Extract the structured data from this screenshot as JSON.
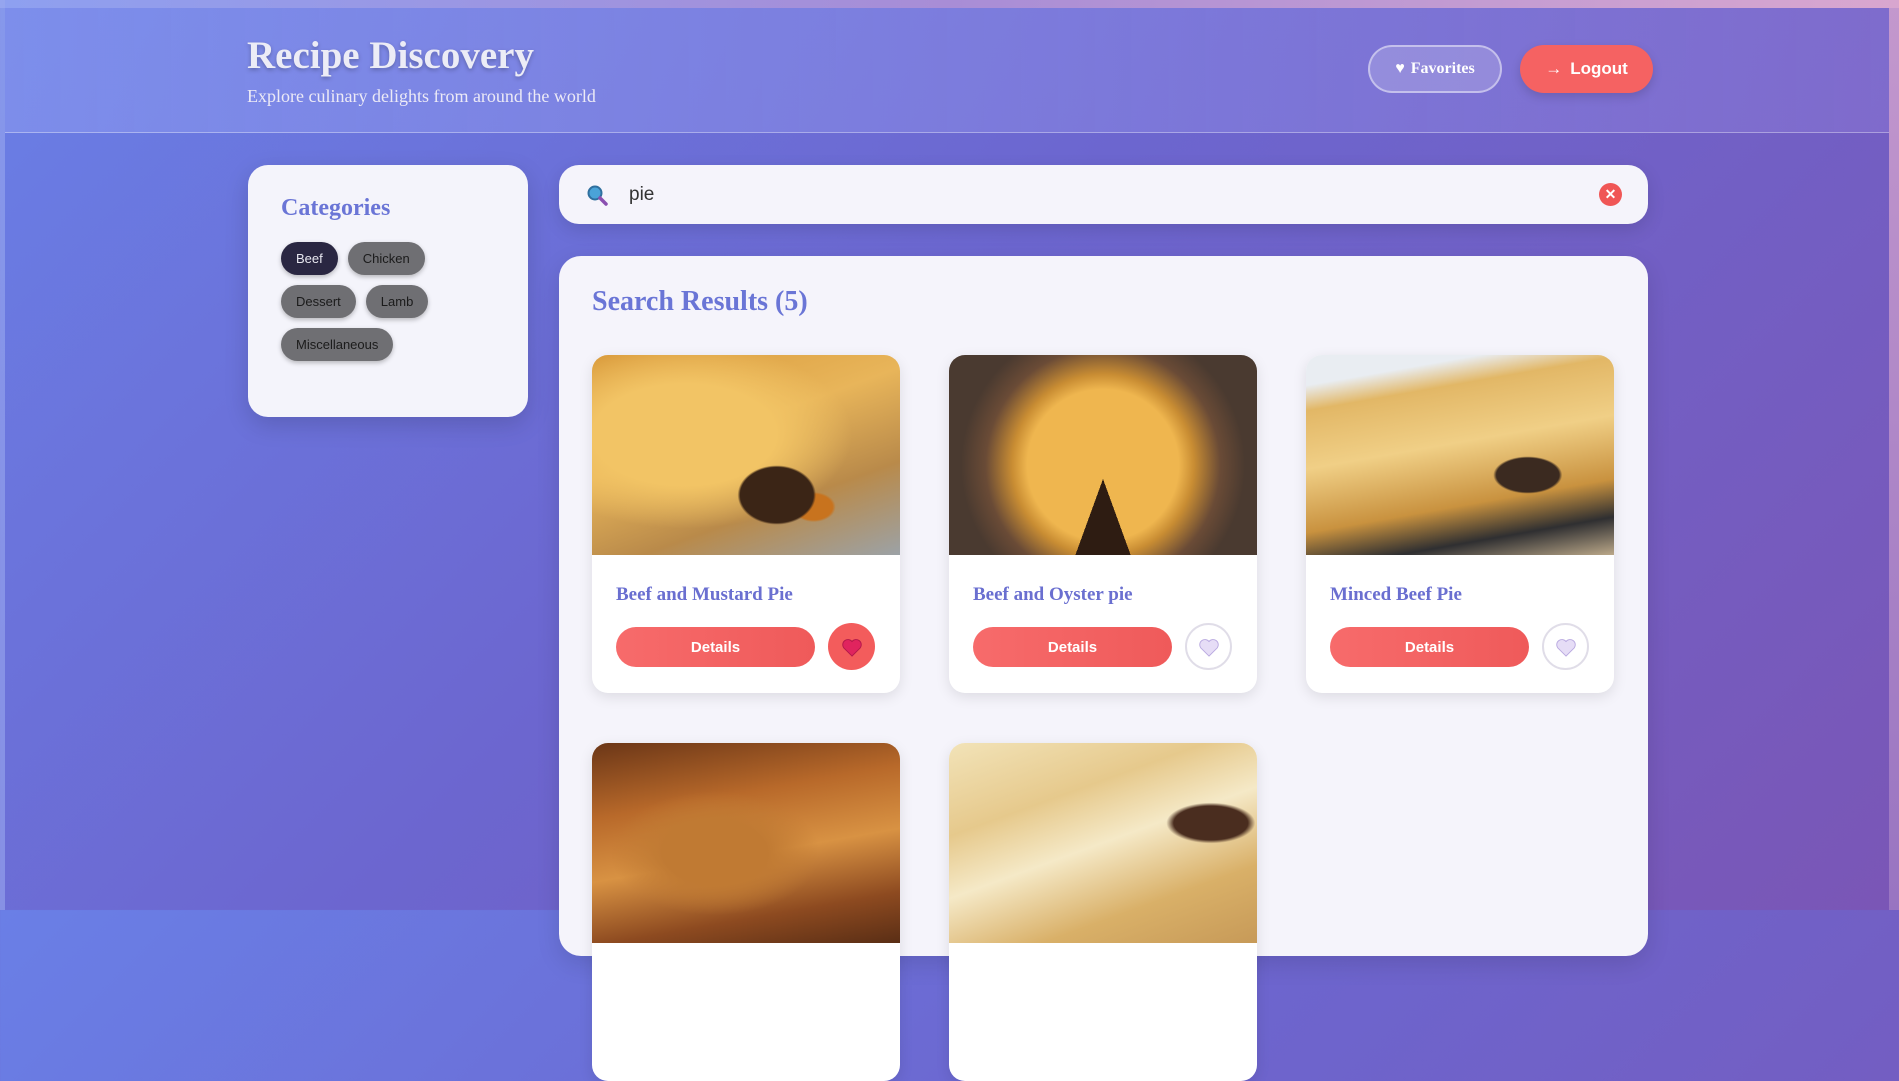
{
  "header": {
    "title": "Recipe Discovery",
    "subtitle": "Explore culinary delights from around the world",
    "favorites_label": "Favorites",
    "logout_label": "Logout"
  },
  "sidebar": {
    "title": "Categories",
    "categories": [
      "Beef",
      "Chicken",
      "Dessert",
      "Lamb",
      "Miscellaneous"
    ],
    "selected": "Beef"
  },
  "search": {
    "value": "pie"
  },
  "results": {
    "heading": "Search Results (5)",
    "details_label": "Details",
    "recipes": [
      {
        "name": "Beef and Mustard Pie",
        "favorited": true
      },
      {
        "name": "Beef and Oyster pie",
        "favorited": false
      },
      {
        "name": "Minced Beef Pie",
        "favorited": false
      },
      {
        "name": "",
        "favorited": false
      },
      {
        "name": "",
        "favorited": false
      }
    ]
  },
  "colors": {
    "accent": "#6a75d6",
    "danger": "#f56262",
    "selected_chip": "#2a2742"
  }
}
